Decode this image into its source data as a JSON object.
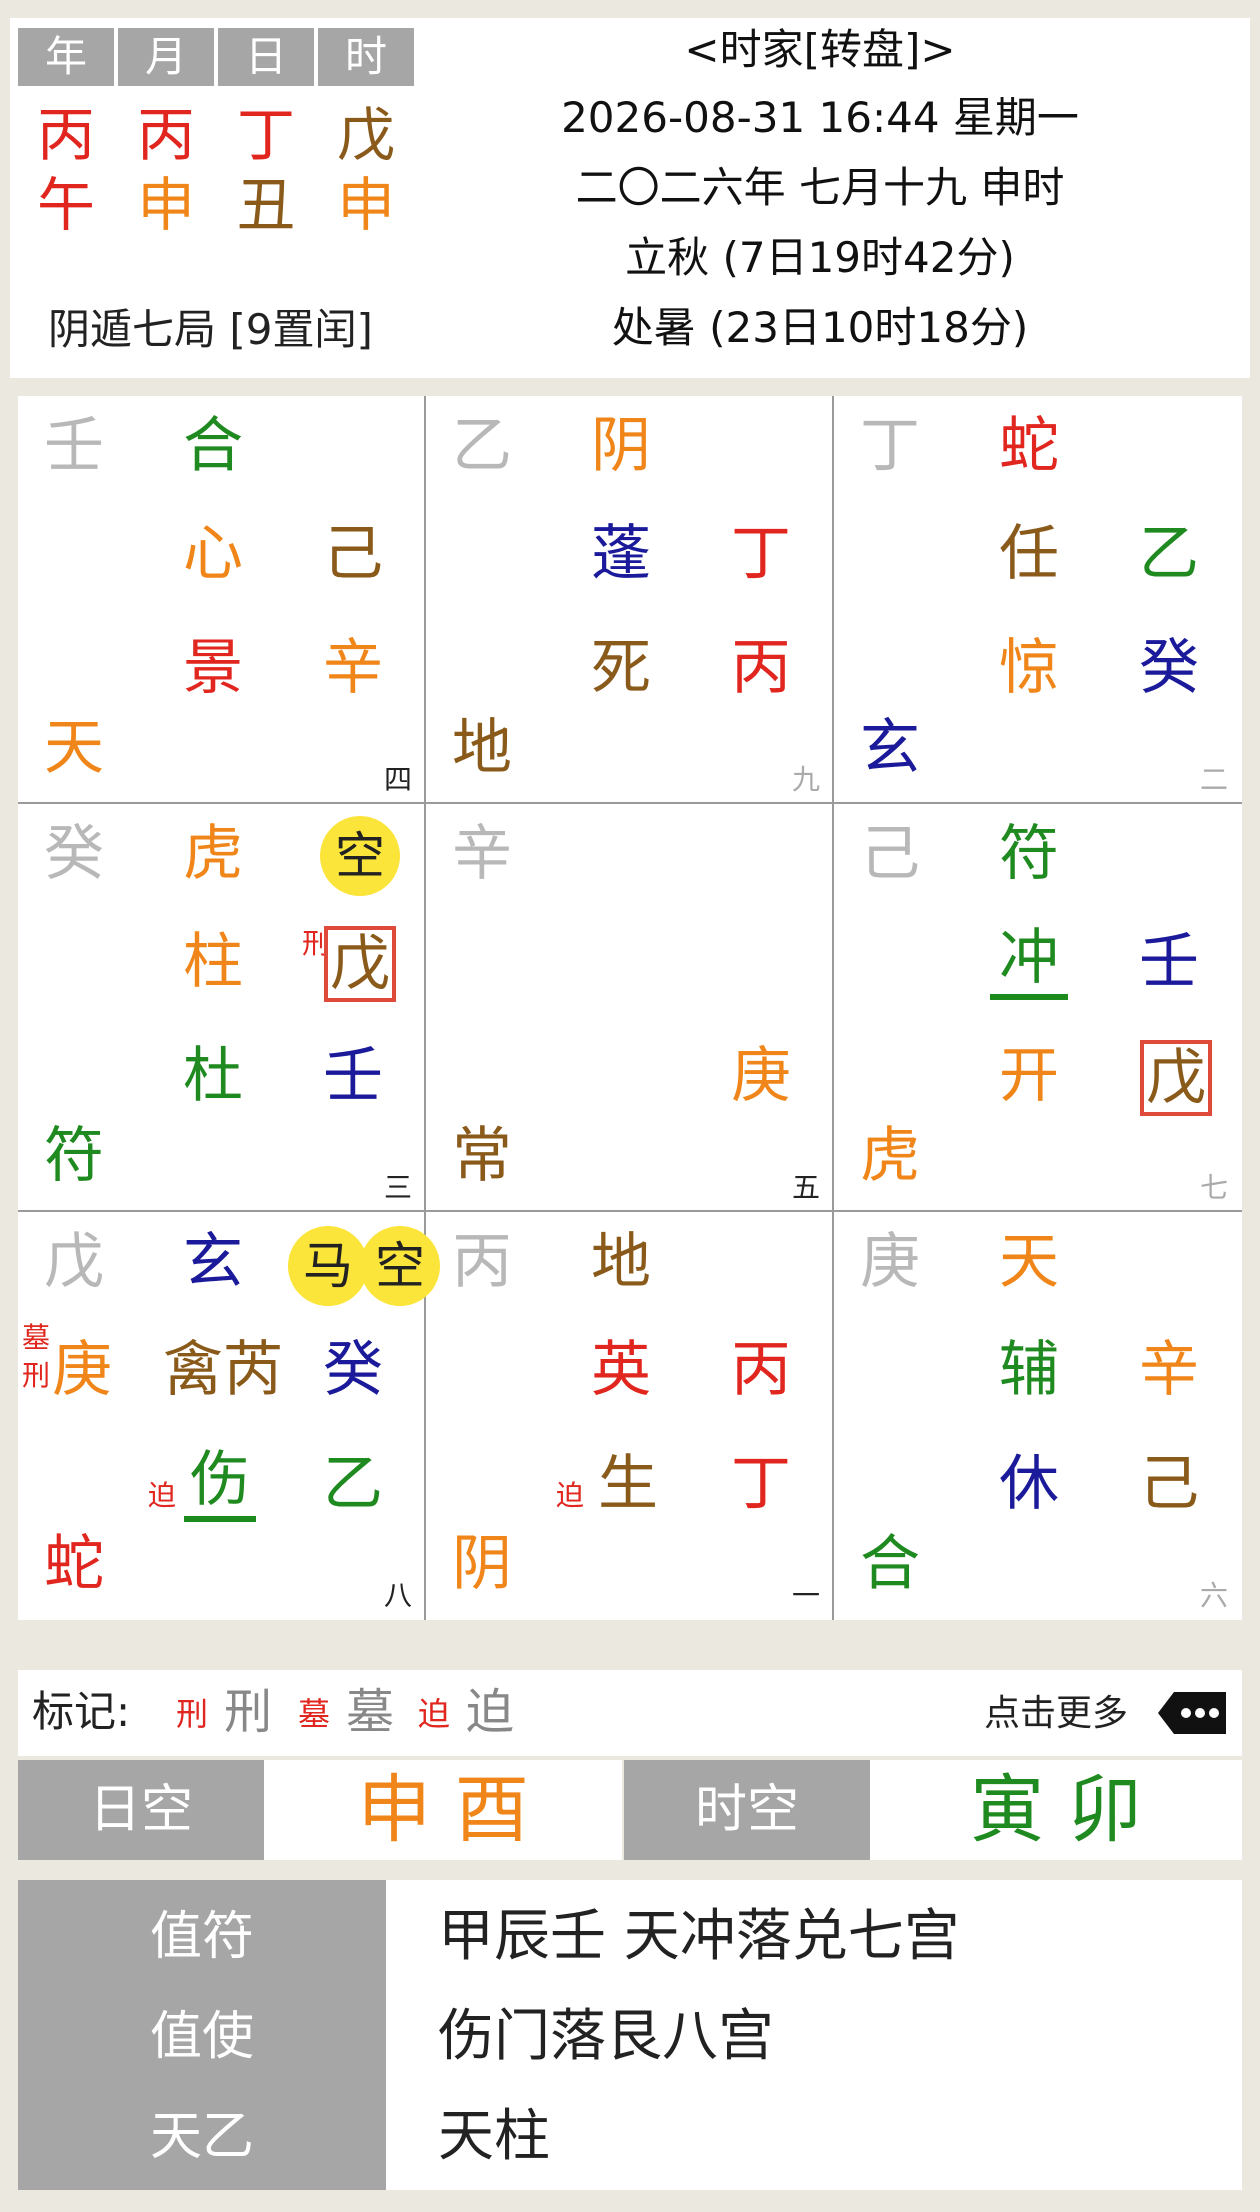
{
  "header": {
    "tabs": [
      "年",
      "月",
      "日",
      "时"
    ],
    "stems": [
      "丙",
      "丙",
      "丁",
      "戊"
    ],
    "branches": [
      "午",
      "申",
      "丑",
      "申"
    ],
    "ju": "阴遁七局 [9置闰]",
    "title": "<时家[转盘]>",
    "datetime": "2026-08-31 16:44 星期一",
    "lunar": "二〇二六年 七月十九 申时",
    "term1": "立秋 (7日19时42分)",
    "term2": "处暑 (23日10时18分)"
  },
  "palaces": [
    {
      "num": "四",
      "corner": "壬",
      "god": "合",
      "star": "心",
      "door": "景",
      "tian": "己",
      "di": "辛",
      "deity": "天"
    },
    {
      "num": "九",
      "corner": "乙",
      "god": "阴",
      "star": "蓬",
      "door": "死",
      "tian": "丁",
      "di": "丙",
      "deity": "地"
    },
    {
      "num": "二",
      "corner": "丁",
      "god": "蛇",
      "star": "任",
      "door": "惊",
      "tian": "乙",
      "di": "癸",
      "deity": "玄"
    },
    {
      "num": "三",
      "corner": "癸",
      "god": "虎",
      "star": "柱",
      "door": "杜",
      "tian": "戊",
      "di": "壬",
      "deity": "符",
      "kong": "空",
      "mark": "刑"
    },
    {
      "num": "五",
      "corner": "辛",
      "di": "庚",
      "deity": "常"
    },
    {
      "num": "七",
      "corner": "己",
      "god": "符",
      "star": "冲",
      "door": "开",
      "tian": "壬",
      "di": "戊",
      "deity": "虎"
    },
    {
      "num": "八",
      "corner": "戊",
      "god": "玄",
      "star": "禽芮",
      "door": "伤",
      "tian": "癸",
      "di": "乙",
      "deity": "蛇",
      "ma": "马",
      "kong": "空",
      "mark1": "墓",
      "mark2": "刑",
      "left": "庚",
      "door_mark": "迫"
    },
    {
      "num": "一",
      "corner": "丙",
      "god": "地",
      "star": "英",
      "door": "生",
      "tian": "丙",
      "di": "丁",
      "deity": "阴",
      "door_mark": "迫"
    },
    {
      "num": "六",
      "corner": "庚",
      "god": "天",
      "star": "辅",
      "door": "休",
      "tian": "辛",
      "di": "己",
      "deity": "合"
    }
  ],
  "legend": {
    "label": "标记:",
    "items": [
      {
        "small": "刑",
        "big": "刑"
      },
      {
        "small": "墓",
        "big": "墓"
      },
      {
        "small": "迫",
        "big": "迫"
      }
    ],
    "more": "点击更多"
  },
  "kong": {
    "day_label": "日空",
    "day_value": "申 酉",
    "hour_label": "时空",
    "hour_value": "寅 卯"
  },
  "info": [
    {
      "label": "值符",
      "value": "甲辰壬  天冲落兑七宫"
    },
    {
      "label": "值使",
      "value": "伤门落艮八宫"
    },
    {
      "label": "天乙",
      "value": "天柱"
    }
  ],
  "colors": {
    "red": "#e0261e",
    "orange": "#f0861a",
    "brown": "#8a5a1a",
    "green": "#1f8a1f",
    "navy": "#1a1a9a"
  }
}
